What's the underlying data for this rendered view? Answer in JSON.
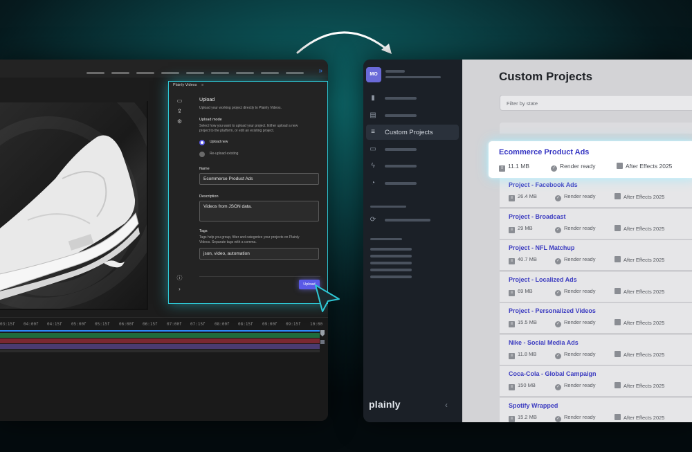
{
  "plugin": {
    "panel_title": "Plainly Videos",
    "section_title": "Upload",
    "section_desc": "Upload your working project directly to Plainly Videos.",
    "mode_label": "Upload mode",
    "mode_desc_1": "Select how you want to upload your project. Either upload a new",
    "mode_desc_2": "project to the platform, or edit an existing project.",
    "options": [
      "Upload new",
      "Re-upload existing"
    ],
    "name_label": "Name",
    "name_value": "Ecommerce Product Ads",
    "description_label": "Description",
    "description_value": "Videos from JSON data.",
    "tags_label": "Tags",
    "tags_desc_1": "Tags help you group, filter and categorize your projects on Plainly",
    "tags_desc_2": "Videos. Separate tags with a comma.",
    "tags_value": "json, video, automation",
    "upload_button": "Upload"
  },
  "timeline": {
    "ticks": [
      "03:15f",
      "04:00f",
      "04:15f",
      "05:00f",
      "05:15f",
      "06:00f",
      "06:15f",
      "07:00f",
      "07:15f",
      "08:00f",
      "08:15f",
      "09:00f",
      "09:15f",
      "10:00"
    ]
  },
  "plainly": {
    "avatar": "MO",
    "active_nav": "Custom Projects",
    "logo": "plainly",
    "page_title": "Custom Projects",
    "filter_placeholder": "Filter by state",
    "highlighted": {
      "name": "Ecommerce Product Ads",
      "size": "11.1 MB",
      "status": "Render ready",
      "app": "After Effects 2025"
    },
    "projects": [
      {
        "name": "Project - Facebook Ads",
        "size": "26.4 MB",
        "status": "Render ready",
        "app": "After Effects 2025"
      },
      {
        "name": "Project - Broadcast",
        "size": "29 MB",
        "status": "Render ready",
        "app": "After Effects 2025"
      },
      {
        "name": "Project - NFL Matchup",
        "size": "40.7 MB",
        "status": "Render ready",
        "app": "After Effects 2025"
      },
      {
        "name": "Project - Localized Ads",
        "size": "69 MB",
        "status": "Render ready",
        "app": "After Effects 2025"
      },
      {
        "name": "Project - Personalized Videos",
        "size": "15.5 MB",
        "status": "Render ready",
        "app": "After Effects 2025"
      },
      {
        "name": "Nike - Social Media Ads",
        "size": "11.8 MB",
        "status": "Render ready",
        "app": "After Effects 2025"
      },
      {
        "name": "Coca-Cola - Global Campaign",
        "size": "150 MB",
        "status": "Render ready",
        "app": "After Effects 2025"
      },
      {
        "name": "Spotify Wrapped",
        "size": "15.2 MB",
        "status": "Render ready",
        "app": "After Effects 2025"
      }
    ]
  },
  "colors": {
    "accent": "#5a5ae6",
    "glow": "#2ec8d6",
    "link": "#3b3bc0"
  }
}
